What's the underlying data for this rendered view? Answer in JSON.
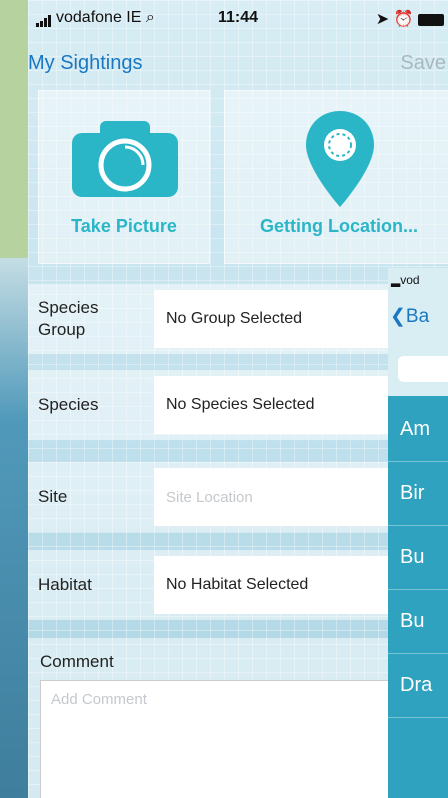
{
  "status_bar": {
    "carrier": "vodafone IE",
    "time": "11:44"
  },
  "nav": {
    "title": "My Sightings",
    "save_label": "Save"
  },
  "tiles": {
    "take_picture": "Take Picture",
    "location": "Getting Location..."
  },
  "form": {
    "species_group": {
      "label": "Species\nGroup",
      "value": "No Group Selected"
    },
    "species": {
      "label": "Species",
      "value": "No Species Selected"
    },
    "site": {
      "label": "Site",
      "placeholder": "Site Location"
    },
    "habitat": {
      "label": "Habitat",
      "value": "No Habitat Selected"
    },
    "comment": {
      "label": "Comment",
      "placeholder": "Add Comment"
    }
  },
  "overlay": {
    "carrier": "vod",
    "back_label": "Ba",
    "items": [
      "Am",
      "Bir",
      "Bu",
      "Bu",
      "Dra"
    ]
  },
  "colors": {
    "accent": "#1a78c2",
    "tile_icon": "#2bb6c8",
    "list_background": "#2ea2be"
  }
}
